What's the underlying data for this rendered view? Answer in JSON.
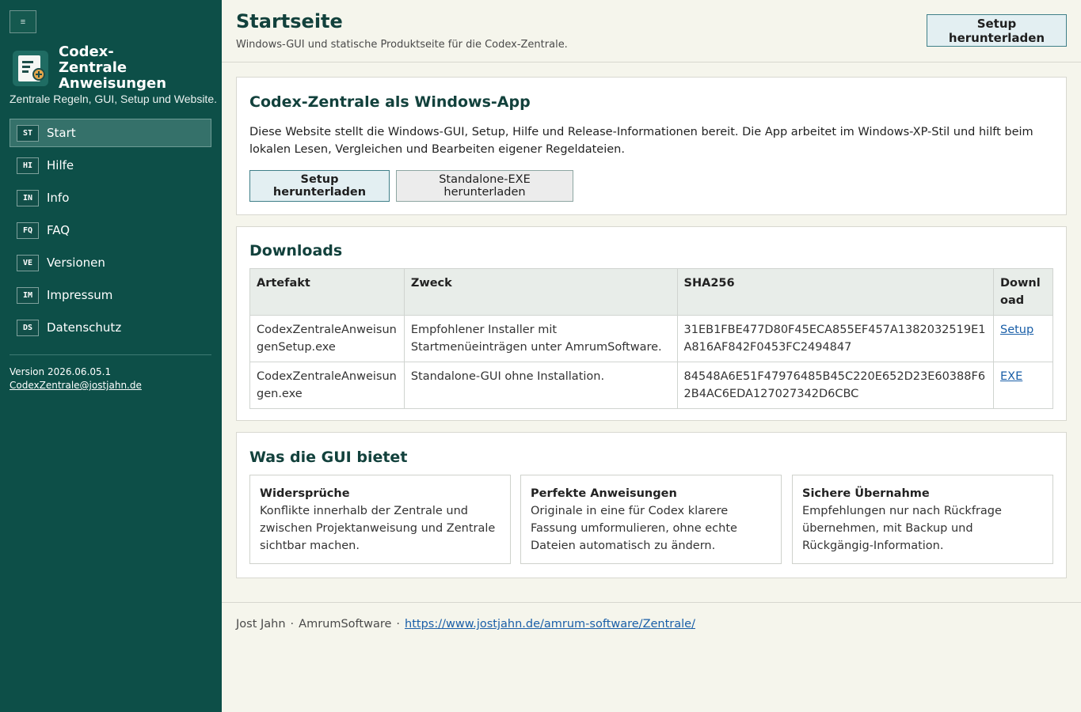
{
  "sidebar": {
    "toggle_icon": "≡",
    "brand_name": "Codex-Zentrale Anweisungen",
    "tagline": "Zentrale Regeln, GUI, Setup und Website.",
    "nav": [
      {
        "badge": "ST",
        "label": "Start",
        "active": true
      },
      {
        "badge": "HI",
        "label": "Hilfe"
      },
      {
        "badge": "IN",
        "label": "Info"
      },
      {
        "badge": "FQ",
        "label": "FAQ"
      },
      {
        "badge": "VE",
        "label": "Versionen"
      },
      {
        "badge": "IM",
        "label": "Impressum"
      },
      {
        "badge": "DS",
        "label": "Datenschutz"
      }
    ],
    "version": "Version 2026.06.05.1",
    "email": "CodexZentrale@jostjahn.de"
  },
  "header": {
    "title": "Startseite",
    "subtitle": "Windows-GUI und statische Produktseite für die Codex-Zentrale.",
    "button": "Setup herunterladen"
  },
  "intro": {
    "title": "Codex-Zentrale als Windows-App",
    "text": "Diese Website stellt die Windows-GUI, Setup, Hilfe und Release-Informationen bereit. Die App arbeitet im Windows-XP-Stil und hilft beim lokalen Lesen, Vergleichen und Bearbeiten eigener Regeldateien.",
    "primary_button": "Setup herunterladen",
    "secondary_button": "Standalone-EXE herunterladen"
  },
  "downloads": {
    "title": "Downloads",
    "columns": [
      "Artefakt",
      "Zweck",
      "SHA256",
      "Download"
    ],
    "rows": [
      {
        "artifact": "CodexZentraleAnweisungenSetup.exe",
        "purpose": "Empfohlener Installer mit Startmenüeinträgen unter AmrumSoftware.",
        "sha": "31EB1FBE477D80F45ECA855EF457A1382032519E1A816AF842F0453FC2494847",
        "link": "Setup"
      },
      {
        "artifact": "CodexZentraleAnweisungen.exe",
        "purpose": "Standalone-GUI ohne Installation.",
        "sha": "84548A6E51F47976485B45C220E652D23E60388F62B4AC6EDA127027342D6CBC",
        "link": "EXE"
      }
    ]
  },
  "features": {
    "title": "Was die GUI bietet",
    "cards": [
      {
        "title": "Widersprüche",
        "text": "Konflikte innerhalb der Zentrale und zwischen Projektanweisung und Zentrale sichtbar machen."
      },
      {
        "title": "Perfekte Anweisungen",
        "text": "Originale in eine für Codex klarere Fassung umformulieren, ohne echte Dateien automatisch zu ändern."
      },
      {
        "title": "Sichere Übernahme",
        "text": "Empfehlungen nur nach Rückfrage übernehmen, mit Backup und Rückgängig-Information."
      }
    ]
  },
  "footer": {
    "author": "Jost Jahn",
    "company": "AmrumSoftware",
    "separator": "·",
    "url": "https://www.jostjahn.de/amrum-software/Zentrale/"
  },
  "colors": {
    "sidebar_bg": "#0d4f48",
    "accent": "#12413c",
    "link": "#1a5fa8",
    "page_bg": "#f5f5ec"
  }
}
